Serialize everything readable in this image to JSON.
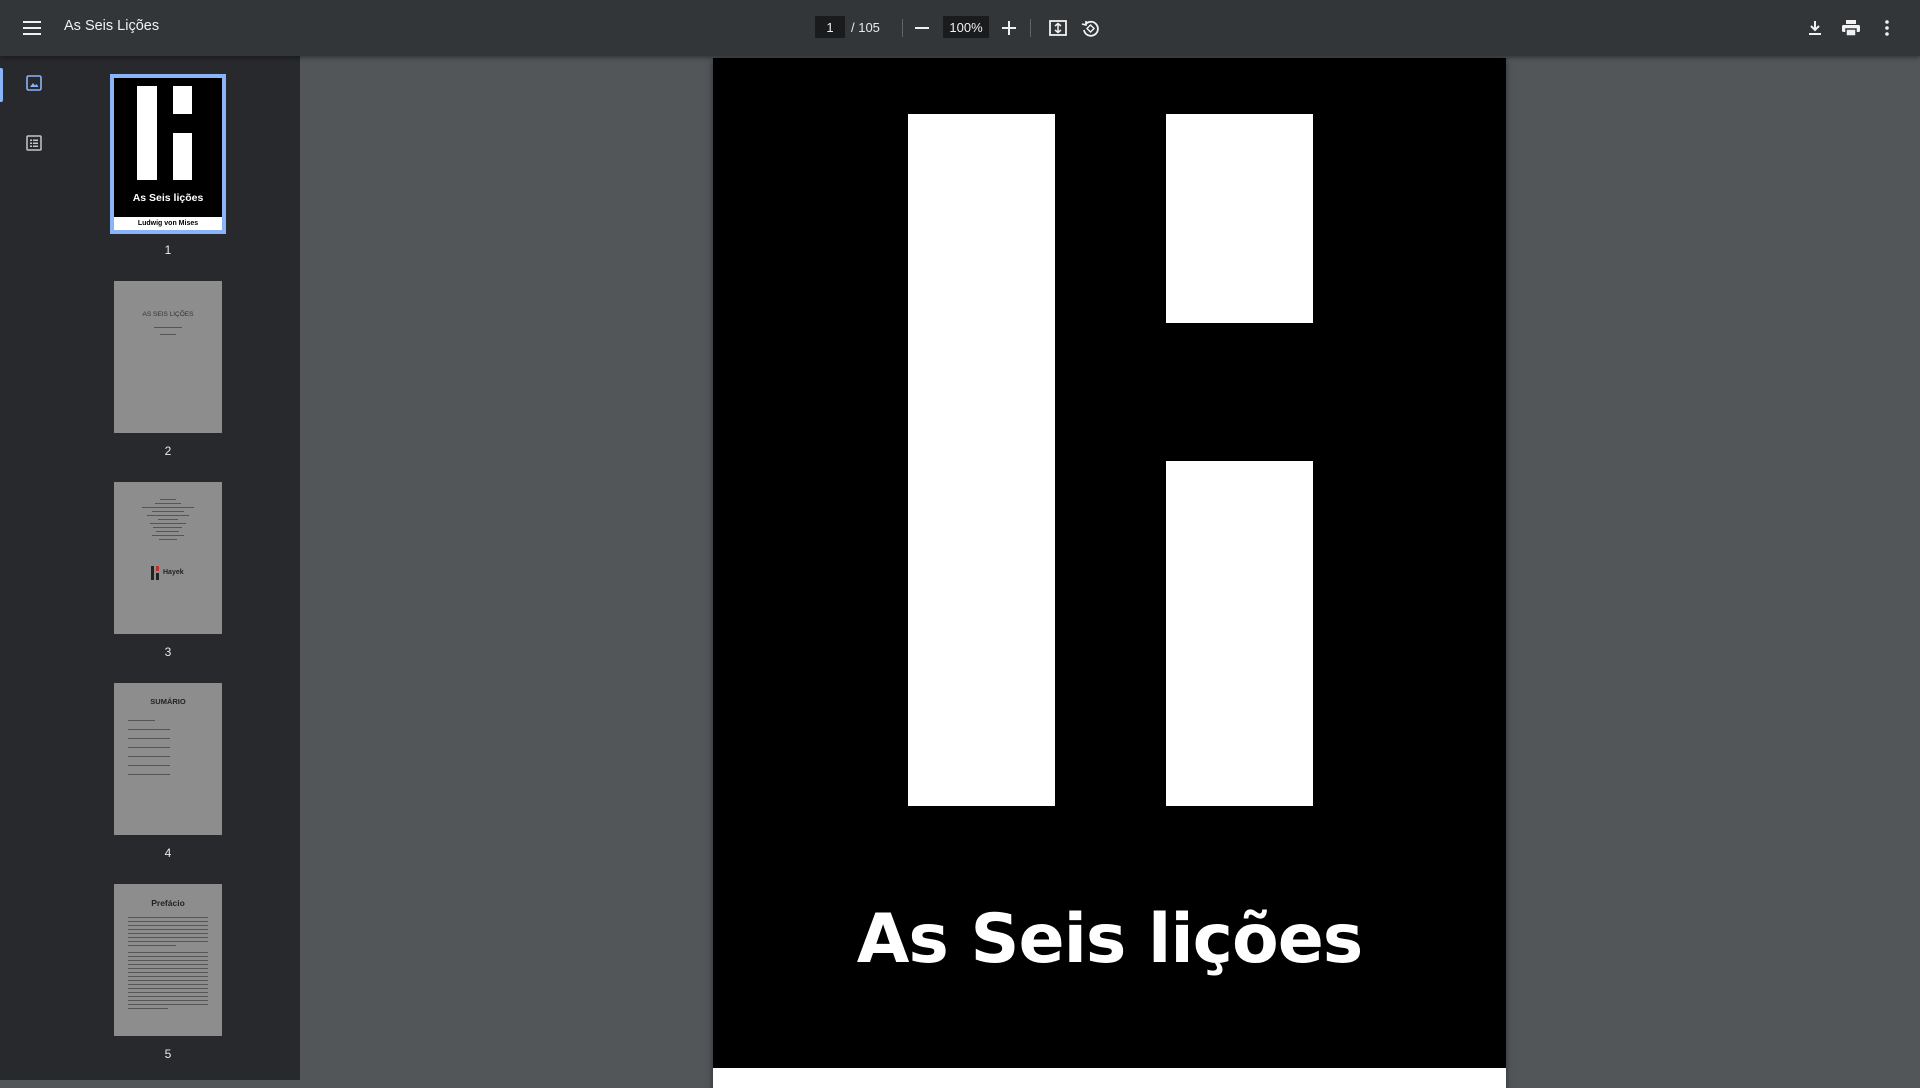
{
  "toolbar": {
    "title": "As Seis Lições",
    "current_page": "1",
    "page_total": "/ 105",
    "zoom": "100%",
    "icons": {
      "menu": "menu-icon",
      "zoom_out": "minus-icon",
      "zoom_in": "plus-icon",
      "fit": "fit-page-icon",
      "rotate": "rotate-icon",
      "download": "download-icon",
      "print": "print-icon",
      "more": "more-vert-icon"
    }
  },
  "sidebar": {
    "rail": [
      {
        "icon": "thumbnail-icon",
        "active": true
      },
      {
        "icon": "outline-icon",
        "active": false
      }
    ],
    "thumbnails": [
      {
        "num": "1",
        "title": "As Seis lições",
        "author": "Ludwig von Mises"
      },
      {
        "num": "2",
        "title": "AS SEIS LIÇÕES"
      },
      {
        "num": "3",
        "title": "Hayek"
      },
      {
        "num": "4",
        "title": "SUMÁRIO"
      },
      {
        "num": "5",
        "title": "Prefácio"
      }
    ]
  },
  "document": {
    "cover_title": "As Seis lições"
  },
  "colors": {
    "toolbar_bg": "#323639",
    "sidebar_bg": "#28292c",
    "viewer_bg": "#525659",
    "accent": "#8ab4f8"
  }
}
